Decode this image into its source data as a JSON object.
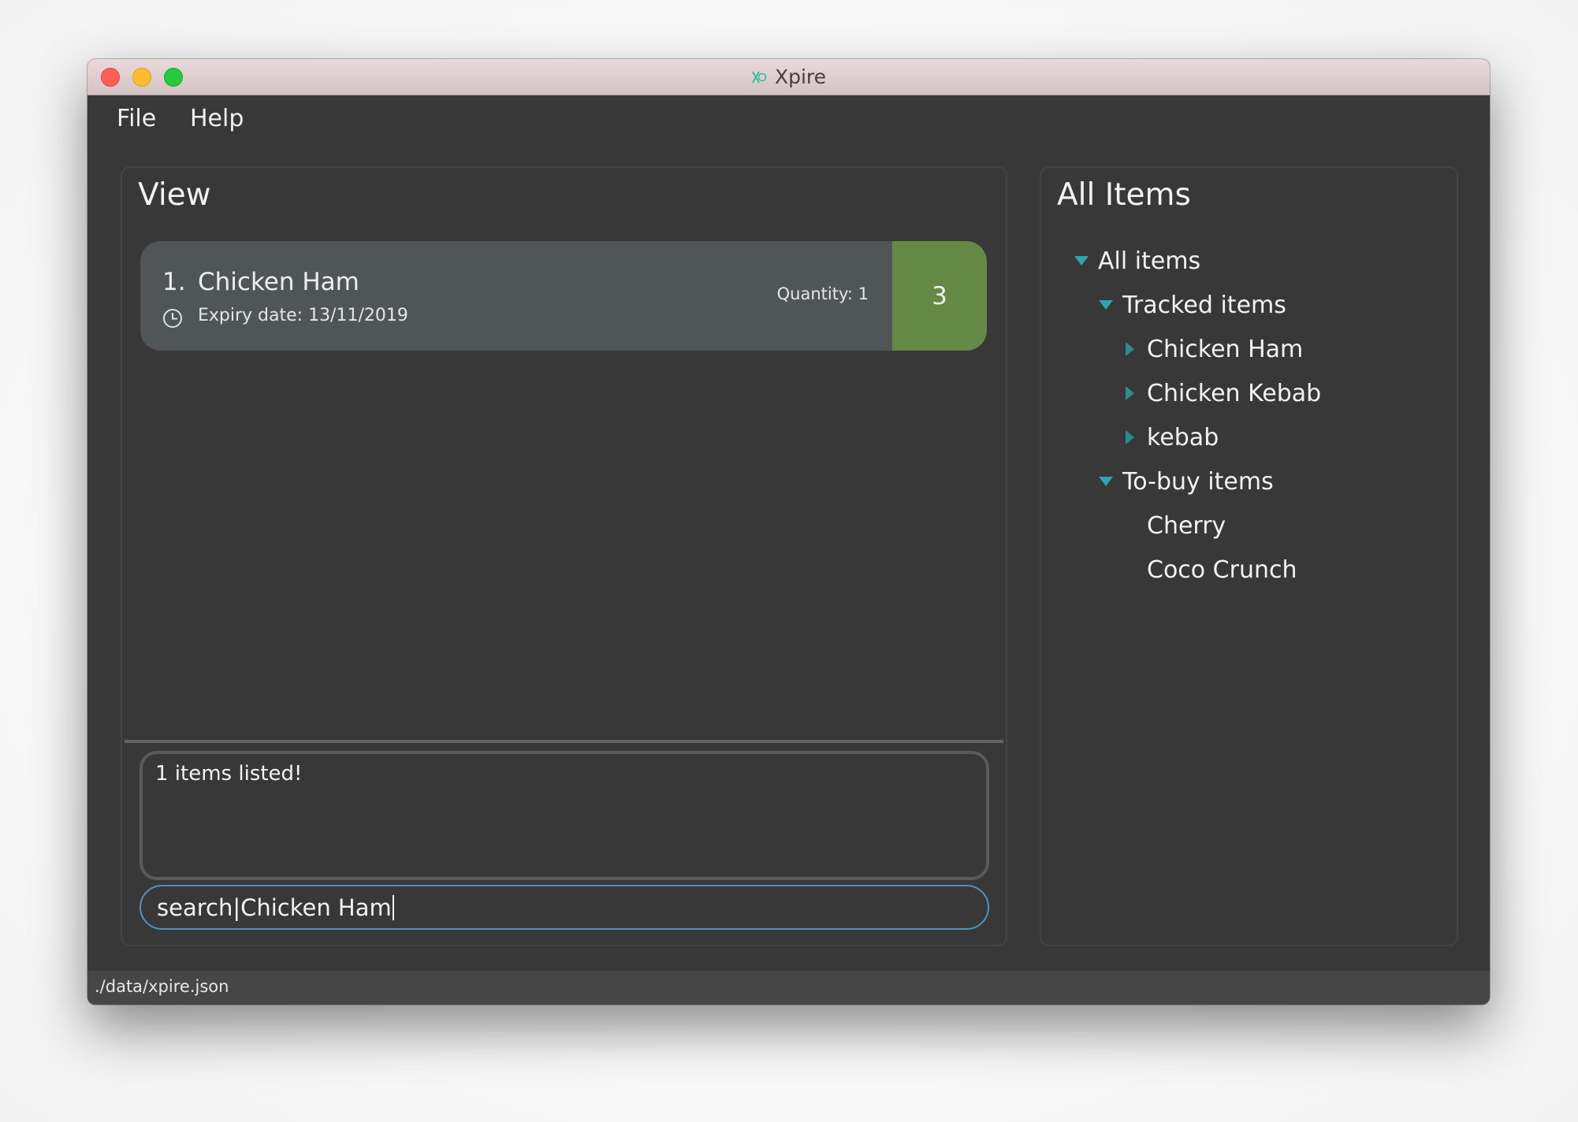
{
  "window": {
    "title": "Xpire",
    "app_icon": "xpire-app-icon"
  },
  "menu": {
    "items": [
      {
        "label": "File"
      },
      {
        "label": "Help"
      }
    ]
  },
  "view_panel": {
    "title": "View",
    "items": [
      {
        "index": "1.",
        "name": "Chicken Ham",
        "expiry_label": "Expiry date: 13/11/2019",
        "quantity_label": "Quantity: 1",
        "days_left": "3",
        "days_color": "#638944",
        "icon": "clock-icon"
      }
    ],
    "result_text": "1 items listed!",
    "command_input": {
      "value": "search|Chicken Ham",
      "placeholder": ""
    }
  },
  "all_items_panel": {
    "title": "All Items",
    "tree": [
      {
        "label": "All items",
        "level": 0,
        "state": "expanded"
      },
      {
        "label": "Tracked items",
        "level": 1,
        "state": "expanded"
      },
      {
        "label": "Chicken Ham",
        "level": 2,
        "state": "collapsed"
      },
      {
        "label": "Chicken Kebab",
        "level": 2,
        "state": "collapsed"
      },
      {
        "label": "kebab",
        "level": 2,
        "state": "collapsed"
      },
      {
        "label": "To-buy items",
        "level": 1,
        "state": "expanded"
      },
      {
        "label": "Cherry",
        "level": 2,
        "state": "leaf"
      },
      {
        "label": "Coco Crunch",
        "level": 2,
        "state": "leaf"
      }
    ],
    "arrow_color": "#2fa3b0"
  },
  "status_bar": {
    "file_path": "./data/xpire.json"
  }
}
